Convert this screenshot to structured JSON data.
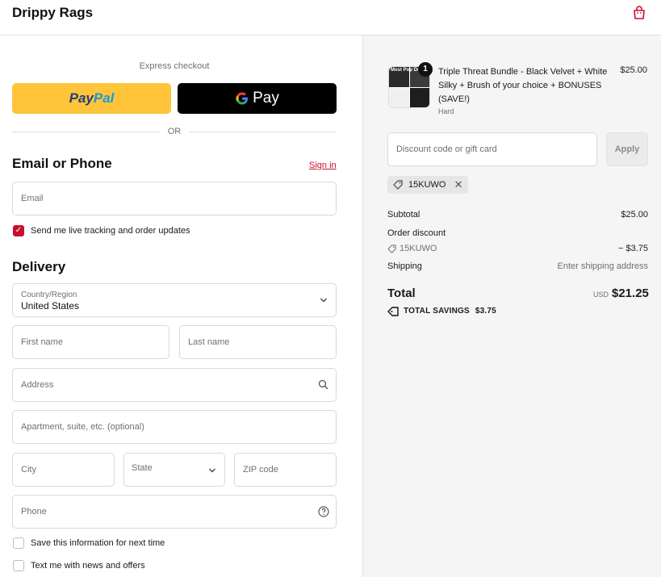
{
  "header": {
    "brand": "Drippy Rags",
    "cart_icon": "shopping-bag-icon"
  },
  "express": {
    "label": "Express checkout",
    "paypal_part1": "Pay",
    "paypal_part2": "Pal",
    "gpay_g": "G",
    "gpay_text": "Pay",
    "divider_text": "OR"
  },
  "contact": {
    "title": "Email or Phone",
    "sign_in": "Sign in",
    "email_placeholder": "Email",
    "tracking_checkbox_label": "Send me live tracking and order updates",
    "tracking_checked": true
  },
  "delivery": {
    "title": "Delivery",
    "country_label": "Country/Region",
    "country_value": "United States",
    "first_name": "First name",
    "last_name": "Last name",
    "address": "Address",
    "apartment": "Apartment, suite, etc. (optional)",
    "city": "City",
    "state": "State",
    "zip": "ZIP code",
    "phone": "Phone",
    "save_info_label": "Save this information for next time",
    "news_label": "Text me with news and offers"
  },
  "order": {
    "quantity": "1",
    "product_title": "Triple Threat Bundle - Black Velvet + White Silky + Brush of your choice + BONUSES (SAVE!)",
    "product_variant": "Hard",
    "product_price": "$25.00",
    "thumb_text": "Most Pop Drip",
    "discount_placeholder": "Discount code or gift card",
    "apply_label": "Apply",
    "applied_code": "15KUWO",
    "subtotal_label": "Subtotal",
    "subtotal_value": "$25.00",
    "order_discount_label": "Order discount",
    "discount_code": "15KUWO",
    "discount_value": "− $3.75",
    "shipping_label": "Shipping",
    "shipping_value": "Enter shipping address",
    "total_label": "Total",
    "currency": "USD",
    "total_value": "$21.25",
    "savings_label": "TOTAL SAVINGS",
    "savings_value": "$3.75"
  },
  "colors": {
    "accent": "#c8102e",
    "paypal_yellow": "#ffc439",
    "summary_bg": "#f5f5f5"
  }
}
